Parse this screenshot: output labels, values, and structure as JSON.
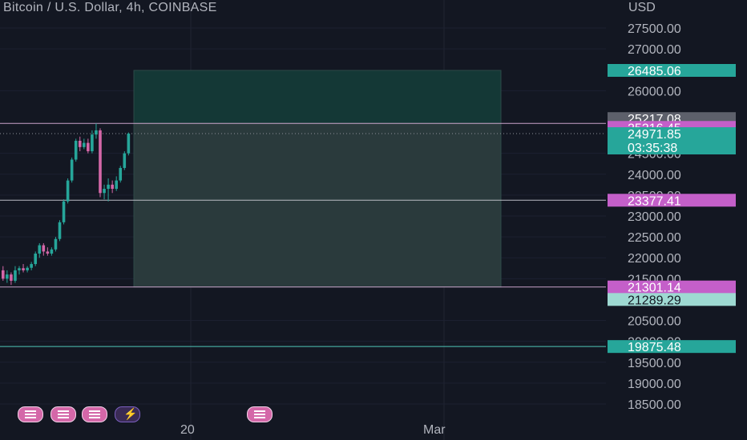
{
  "header": {
    "title": "Bitcoin / U.S. Dollar, 4h, COINBASE",
    "currency": "USD"
  },
  "colors": {
    "up": "#26a69a",
    "down": "#d467a8",
    "zone": "#1f3d3b",
    "zone_top": "#143836",
    "background": "#131722",
    "text": "#b2b5be"
  },
  "chart_data": {
    "type": "candlestick",
    "title": "Bitcoin / U.S. Dollar, 4h, COINBASE",
    "y_axis_label": "USD",
    "ylim": [
      18250,
      28000
    ],
    "y_ticks": [
      27500,
      27000,
      26000,
      24500,
      24000,
      23500,
      23000,
      22500,
      22000,
      21500,
      20500,
      20000,
      19500,
      19000,
      18500
    ],
    "x_ticks": [
      "20",
      "Mar"
    ],
    "candles": [
      {
        "o": 21700,
        "h": 21800,
        "l": 21450,
        "c": 21500
      },
      {
        "o": 21500,
        "h": 21700,
        "l": 21400,
        "c": 21600
      },
      {
        "o": 21600,
        "h": 21650,
        "l": 21350,
        "c": 21450
      },
      {
        "o": 21450,
        "h": 21800,
        "l": 21400,
        "c": 21700
      },
      {
        "o": 21700,
        "h": 21800,
        "l": 21600,
        "c": 21750
      },
      {
        "o": 21750,
        "h": 21850,
        "l": 21650,
        "c": 21700
      },
      {
        "o": 21700,
        "h": 21800,
        "l": 21650,
        "c": 21760
      },
      {
        "o": 21760,
        "h": 21900,
        "l": 21700,
        "c": 21850
      },
      {
        "o": 21850,
        "h": 22150,
        "l": 21800,
        "c": 22100
      },
      {
        "o": 22100,
        "h": 22350,
        "l": 22000,
        "c": 22300
      },
      {
        "o": 22300,
        "h": 22350,
        "l": 22050,
        "c": 22150
      },
      {
        "o": 22150,
        "h": 22250,
        "l": 22050,
        "c": 22100
      },
      {
        "o": 22100,
        "h": 22250,
        "l": 22050,
        "c": 22200
      },
      {
        "o": 22200,
        "h": 22500,
        "l": 22150,
        "c": 22450
      },
      {
        "o": 22450,
        "h": 22900,
        "l": 22400,
        "c": 22850
      },
      {
        "o": 22850,
        "h": 23400,
        "l": 22800,
        "c": 23350
      },
      {
        "o": 23350,
        "h": 23900,
        "l": 23300,
        "c": 23850
      },
      {
        "o": 23850,
        "h": 24400,
        "l": 23800,
        "c": 24350
      },
      {
        "o": 24350,
        "h": 24850,
        "l": 24300,
        "c": 24800
      },
      {
        "o": 24800,
        "h": 24900,
        "l": 24550,
        "c": 24650
      },
      {
        "o": 24650,
        "h": 24850,
        "l": 24600,
        "c": 24750
      },
      {
        "o": 24750,
        "h": 24850,
        "l": 24500,
        "c": 24550
      },
      {
        "o": 24550,
        "h": 25050,
        "l": 24500,
        "c": 24950
      },
      {
        "o": 24950,
        "h": 25217.08,
        "l": 24850,
        "c": 25050
      },
      {
        "o": 25050,
        "h": 25100,
        "l": 23450,
        "c": 23550
      },
      {
        "o": 23550,
        "h": 23750,
        "l": 23400,
        "c": 23650
      },
      {
        "o": 23650,
        "h": 23900,
        "l": 23350,
        "c": 23750
      },
      {
        "o": 23750,
        "h": 23850,
        "l": 23550,
        "c": 23650
      },
      {
        "o": 23650,
        "h": 23950,
        "l": 23600,
        "c": 23850
      },
      {
        "o": 23850,
        "h": 24200,
        "l": 23800,
        "c": 24150
      },
      {
        "o": 24150,
        "h": 24550,
        "l": 24100,
        "c": 24500
      },
      {
        "o": 24500,
        "h": 25000,
        "l": 24450,
        "c": 24971.85
      }
    ],
    "zone": {
      "upper": 26485.06,
      "middle": 25216.45,
      "lower": 21301.14
    },
    "lines": [
      25216.45,
      23377.41,
      21301.14,
      19875.48
    ],
    "price_tags": [
      {
        "label": "26485.06",
        "value": 26485.06,
        "color": "#26a69a"
      },
      {
        "label": "25217.08",
        "value": 25217.08,
        "color": "#5d606b"
      },
      {
        "label": "25216.45",
        "value": 25216.45,
        "color": "#c45fc9"
      },
      {
        "label": "24971.85",
        "value": 24971.85,
        "color": "#26a69a"
      },
      {
        "label": "23377.41",
        "value": 23377.41,
        "color": "#c45fc9"
      },
      {
        "label": "21301.14",
        "value": 21301.14,
        "color": "#c45fc9"
      },
      {
        "label": "21289.29",
        "value": 21289.29,
        "color": "#9ed9d2"
      },
      {
        "label": "19875.48",
        "value": 19875.48,
        "color": "#26a69a"
      }
    ],
    "countdown": "03:35:38"
  }
}
